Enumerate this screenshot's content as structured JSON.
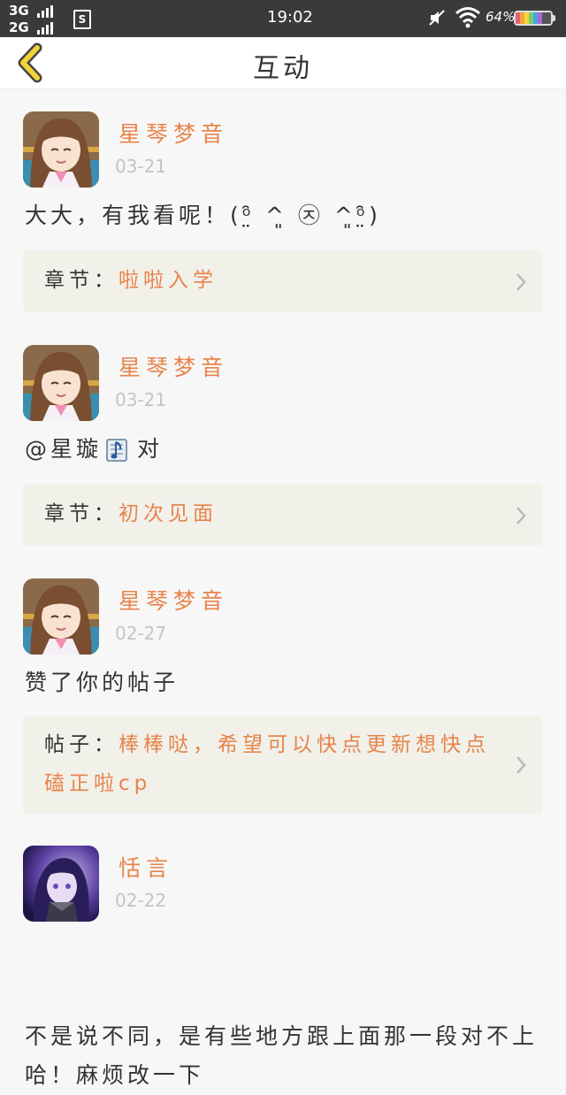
{
  "status_bar": {
    "network_1": "3G",
    "network_2": "2G",
    "sim_icon_label": "S",
    "time": "19:02",
    "battery_percent": "64%",
    "icons": [
      "signal-icon",
      "sim-icon",
      "mute-icon",
      "wifi-icon",
      "battery-icon"
    ]
  },
  "header": {
    "title": "互动",
    "back_icon": "chevron-left-icon",
    "accent_color": "#f2d33a"
  },
  "colors": {
    "accent_orange": "#e8834a",
    "date_gray": "#c4c4c4",
    "card_bg": "#f1f1ea"
  },
  "items": [
    {
      "user": "星琴梦音",
      "date": "03-21",
      "text": "大大，有我看呢！(ᵒ̤̑ ^͈ ㉨ ^͈ᵒ̤̑)",
      "ref_label": "章节：",
      "ref_title": "啦啦入学"
    },
    {
      "user": "星琴梦音",
      "date": "03-21",
      "text_mention": "@星璇",
      "text_after": "对",
      "ref_label": "章节：",
      "ref_title": "初次见面"
    },
    {
      "user": "星琴梦音",
      "date": "02-27",
      "text": "赞了你的帖子",
      "ref_label": "帖子：",
      "ref_title": "棒棒哒，希望可以快点更新想快点磕正啦cp"
    },
    {
      "user": "恬言",
      "date": "02-22",
      "text": "不是说不同，是有些地方跟上面那一段对不上哈！麻烦改一下"
    }
  ]
}
